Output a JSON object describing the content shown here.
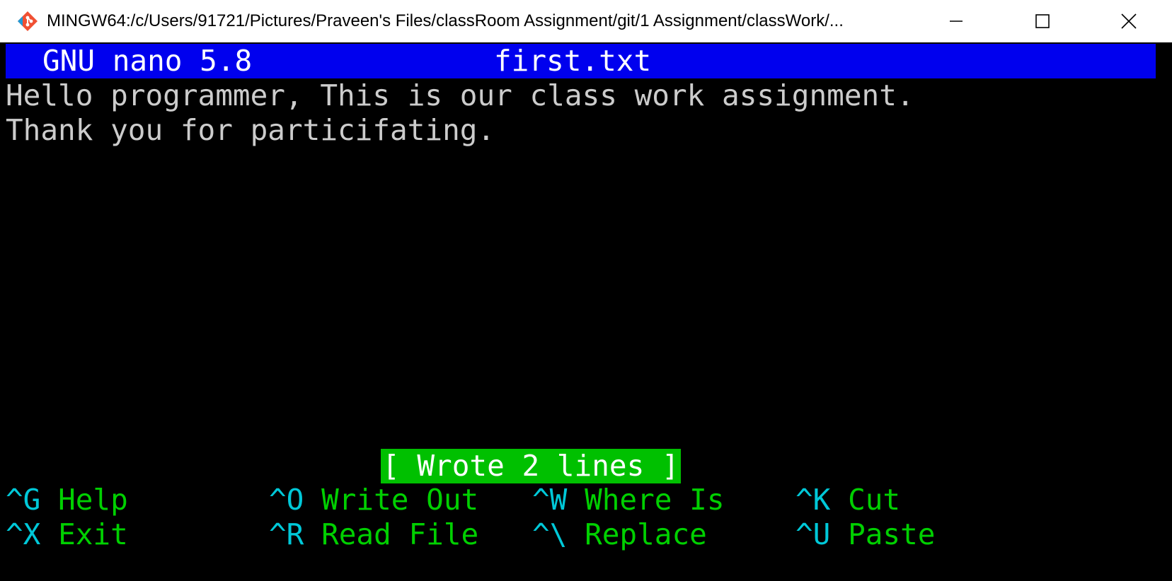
{
  "window": {
    "title": "MINGW64:/c/Users/91721/Pictures/Praveen's Files/classRoom Assignment/git/1 Assignment/classWork/...",
    "app_icon": "git-icon",
    "controls": {
      "minimize_icon": "minimize-icon",
      "maximize_icon": "maximize-icon",
      "close_icon": "close-icon"
    }
  },
  "nano": {
    "version": "GNU nano 5.8",
    "filename": "first.txt",
    "lines": [
      "Hello programmer, This is our class work assignment.",
      "Thank you for particifating."
    ],
    "status": "[ Wrote 2 lines ]",
    "shortcuts": [
      {
        "key": "^G",
        "label": "Help"
      },
      {
        "key": "^O",
        "label": "Write Out"
      },
      {
        "key": "^W",
        "label": "Where Is"
      },
      {
        "key": "^K",
        "label": "Cut"
      },
      {
        "key": "^X",
        "label": "Exit"
      },
      {
        "key": "^R",
        "label": "Read File"
      },
      {
        "key": "^\\",
        "label": "Replace"
      },
      {
        "key": "^U",
        "label": "Paste"
      }
    ]
  },
  "colors": {
    "header_bg": "#0000ee",
    "status_bg": "#00c000",
    "shortcut_key": "#00c8d8",
    "shortcut_label": "#00d000",
    "text": "#cccccc",
    "background": "#000000"
  }
}
